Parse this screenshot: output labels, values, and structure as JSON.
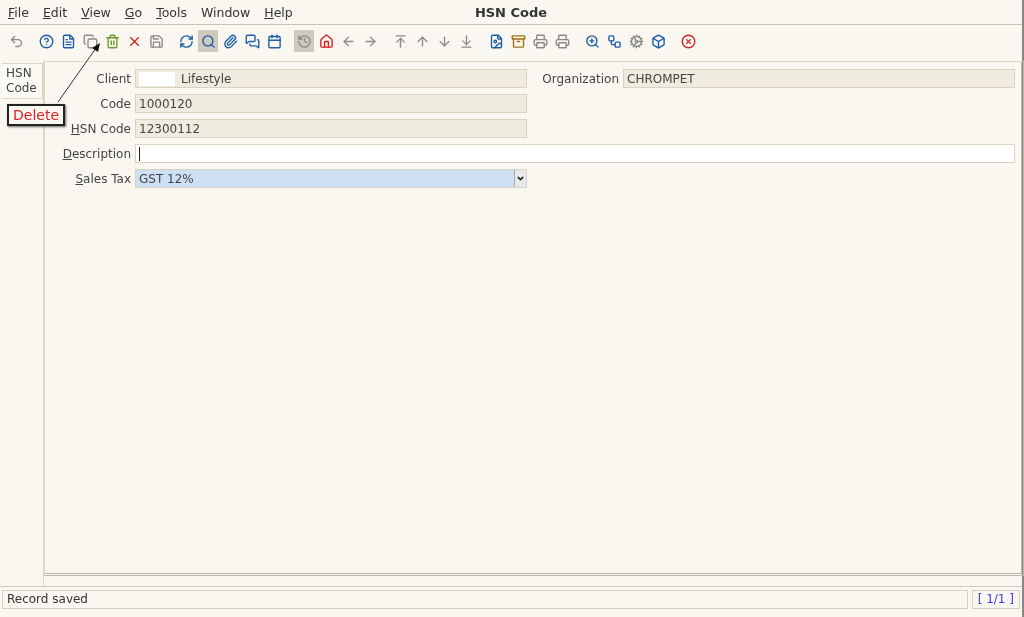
{
  "window": {
    "title": "HSN Code"
  },
  "menu": [
    {
      "label": "File",
      "underlined": true
    },
    {
      "label": "Edit",
      "underlined": true
    },
    {
      "label": "View",
      "underlined": true
    },
    {
      "label": "Go",
      "underlined": true
    },
    {
      "label": "Tools",
      "underlined": true
    },
    {
      "label": "Window",
      "underlined": false
    },
    {
      "label": "Help",
      "underlined": true
    }
  ],
  "toolbar": [
    {
      "kind": "undo",
      "pressed": false,
      "disabled": true
    },
    {
      "kind": "sep"
    },
    {
      "kind": "help",
      "pressed": false,
      "disabled": false
    },
    {
      "kind": "new",
      "pressed": false,
      "disabled": false
    },
    {
      "kind": "copy",
      "pressed": false,
      "disabled": true
    },
    {
      "kind": "delete",
      "pressed": false,
      "disabled": false
    },
    {
      "kind": "delete-selection",
      "pressed": false,
      "disabled": false
    },
    {
      "kind": "save",
      "pressed": false,
      "disabled": true
    },
    {
      "kind": "sep"
    },
    {
      "kind": "refresh",
      "pressed": false,
      "disabled": false
    },
    {
      "kind": "find",
      "pressed": true,
      "disabled": false
    },
    {
      "kind": "attach",
      "pressed": false,
      "disabled": false
    },
    {
      "kind": "chat",
      "pressed": false,
      "disabled": false
    },
    {
      "kind": "calendar",
      "pressed": false,
      "disabled": false
    },
    {
      "kind": "sep"
    },
    {
      "kind": "history",
      "pressed": true,
      "disabled": true
    },
    {
      "kind": "home",
      "pressed": false,
      "disabled": false
    },
    {
      "kind": "back",
      "pressed": false,
      "disabled": true
    },
    {
      "kind": "forward",
      "pressed": false,
      "disabled": true
    },
    {
      "kind": "sep"
    },
    {
      "kind": "first",
      "pressed": false,
      "disabled": true
    },
    {
      "kind": "previous",
      "pressed": false,
      "disabled": true
    },
    {
      "kind": "next",
      "pressed": false,
      "disabled": true
    },
    {
      "kind": "last",
      "pressed": false,
      "disabled": true
    },
    {
      "kind": "sep"
    },
    {
      "kind": "report",
      "pressed": false,
      "disabled": false
    },
    {
      "kind": "archive",
      "pressed": false,
      "disabled": false
    },
    {
      "kind": "print-preview",
      "pressed": false,
      "disabled": true
    },
    {
      "kind": "print",
      "pressed": false,
      "disabled": true
    },
    {
      "kind": "sep"
    },
    {
      "kind": "zoom",
      "pressed": false,
      "disabled": false
    },
    {
      "kind": "workflow",
      "pressed": false,
      "disabled": false
    },
    {
      "kind": "process",
      "pressed": false,
      "disabled": true
    },
    {
      "kind": "product",
      "pressed": false,
      "disabled": false
    },
    {
      "kind": "sep"
    },
    {
      "kind": "close",
      "pressed": false,
      "disabled": false
    }
  ],
  "tabs": [
    {
      "label": "HSN Code",
      "selected": true
    }
  ],
  "callout": {
    "label": "Delete"
  },
  "form": {
    "rows": [
      [
        {
          "label": "Client",
          "underlined": false,
          "value": "Lifestyle",
          "kind": "readonly",
          "redacted": true
        },
        {
          "label": "Organization",
          "underlined": false,
          "value": "CHROMPET",
          "kind": "readonly",
          "redacted": false
        }
      ],
      [
        {
          "label": "Code",
          "underlined": false,
          "value": "1000120",
          "kind": "readonly",
          "redacted": false
        }
      ],
      [
        {
          "label": "HSN Code",
          "underlined": true,
          "value": "12300112",
          "kind": "readonly",
          "redacted": false
        }
      ],
      [
        {
          "label": "Description",
          "underlined": true,
          "kind": "text",
          "redacted": false
        }
      ],
      [
        {
          "label": "Sales Tax",
          "underlined": true,
          "value": "GST 12%",
          "kind": "select",
          "redacted": false
        }
      ]
    ]
  },
  "status_bar": {
    "message": "Record saved",
    "record": "[ 1/1 ]"
  }
}
